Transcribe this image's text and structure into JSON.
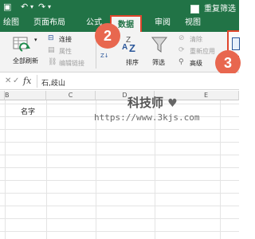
{
  "title_bar": {
    "title": "重复筛选"
  },
  "tabs": [
    {
      "label": "绘图"
    },
    {
      "label": "页面布局"
    },
    {
      "label": "公式"
    },
    {
      "label": "数据"
    },
    {
      "label": "审阅"
    },
    {
      "label": "视图"
    }
  ],
  "ribbon": {
    "refresh_all": "全部刷新",
    "connections": "连接",
    "properties": "属性",
    "edit_links": "编辑链接",
    "sort": "排序",
    "filter": "筛选",
    "clear": "清除",
    "reapply": "重新应用",
    "advanced": "高级"
  },
  "callouts": {
    "c2": "2",
    "c3": "3"
  },
  "formula_bar": {
    "fx_label": "fx",
    "content": "石,歧山"
  },
  "grid": {
    "columns": [
      "B",
      "C",
      "D",
      "E"
    ],
    "cell_c2": "名字"
  },
  "watermark": {
    "line1": "科技师",
    "line2": "https://www.3kjs.com"
  },
  "colors": {
    "excel_green": "#217346",
    "callout": "#e8674f",
    "highlight": "#e0452c"
  }
}
